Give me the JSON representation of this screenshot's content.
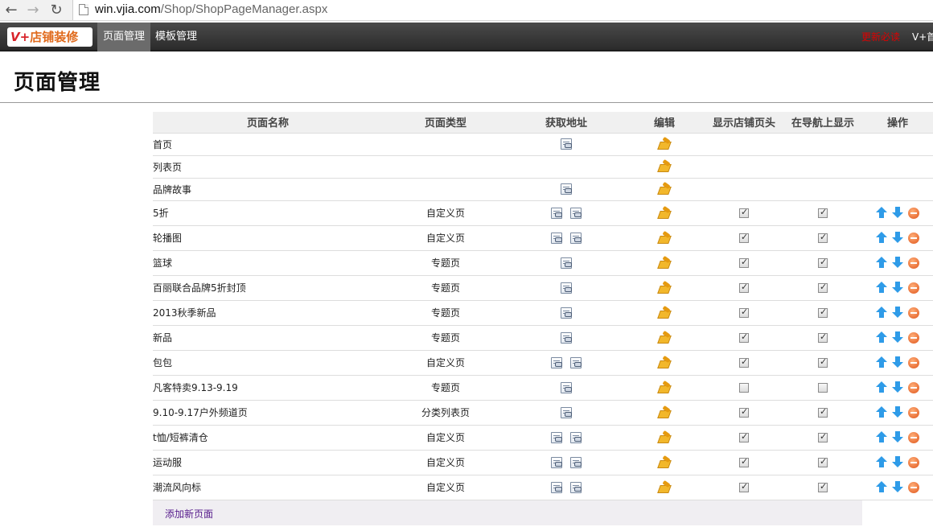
{
  "browser": {
    "url_host": "win.vjia.com",
    "url_path": "/Shop/ShopPageManager.aspx"
  },
  "header": {
    "logo_v": "V+",
    "logo_text": "店铺装修",
    "tabs": [
      "页面管理",
      "模板管理"
    ],
    "active_tab": "页面管理",
    "right_red": "更新必读",
    "right_home": "V+首页"
  },
  "page_title": "页面管理",
  "table": {
    "columns": [
      "页面名称",
      "页面类型",
      "获取地址",
      "编辑",
      "显示店铺页头",
      "在导航上显示",
      "操作"
    ],
    "rows": [
      {
        "name": "首页",
        "type": "",
        "links": 1,
        "header": null,
        "nav": null,
        "ops": false
      },
      {
        "name": "列表页",
        "type": "",
        "links": 0,
        "header": null,
        "nav": null,
        "ops": false
      },
      {
        "name": "品牌故事",
        "type": "",
        "links": 1,
        "header": null,
        "nav": null,
        "ops": false
      },
      {
        "name": "5折",
        "type": "自定义页",
        "links": 2,
        "header": true,
        "nav": true,
        "ops": true
      },
      {
        "name": "轮播图",
        "type": "自定义页",
        "links": 2,
        "header": true,
        "nav": true,
        "ops": true
      },
      {
        "name": "篮球",
        "type": "专题页",
        "links": 1,
        "header": true,
        "nav": true,
        "ops": true
      },
      {
        "name": "百丽联合品牌5折封顶",
        "type": "专题页",
        "links": 1,
        "header": true,
        "nav": true,
        "ops": true
      },
      {
        "name": "2013秋季新品",
        "type": "专题页",
        "links": 1,
        "header": true,
        "nav": true,
        "ops": true
      },
      {
        "name": "新品",
        "type": "专题页",
        "links": 1,
        "header": true,
        "nav": true,
        "ops": true
      },
      {
        "name": "包包",
        "type": "自定义页",
        "links": 2,
        "header": true,
        "nav": true,
        "ops": true
      },
      {
        "name": "凡客特卖9.13-9.19",
        "type": "专题页",
        "links": 1,
        "header": false,
        "nav": false,
        "ops": true
      },
      {
        "name": "9.10-9.17户外频道页",
        "type": "分类列表页",
        "links": 1,
        "header": true,
        "nav": true,
        "ops": true
      },
      {
        "name": "t恤/短裤清仓",
        "type": "自定义页",
        "links": 2,
        "header": true,
        "nav": true,
        "ops": true
      },
      {
        "name": "运动服",
        "type": "自定义页",
        "links": 2,
        "header": true,
        "nav": true,
        "ops": true
      },
      {
        "name": "潮流风向标",
        "type": "自定义页",
        "links": 2,
        "header": true,
        "nav": true,
        "ops": true
      }
    ]
  },
  "add_page_label": "添加新页面"
}
